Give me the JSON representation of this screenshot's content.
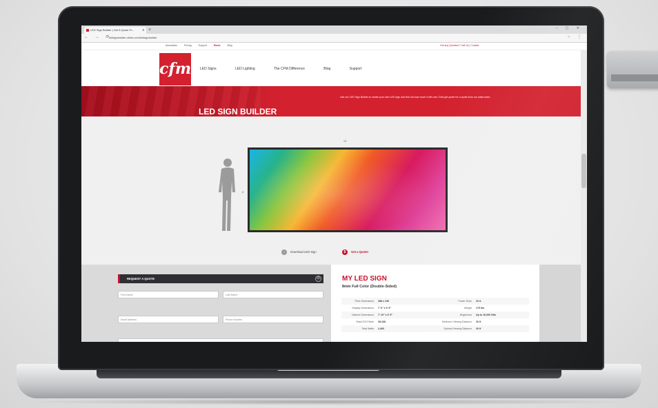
{
  "browser": {
    "tab_title": "LED Sign Builder | Get A Quote Fr...",
    "tab_close": "x",
    "new_tab": "+",
    "window_controls": "– ▢ ✕",
    "nav_glyphs": "← → ⟳",
    "url": "ledsignbuilder.cfmle.com/ledsignbuilder",
    "addr_right": "☆",
    "menu": "⋮"
  },
  "site": {
    "topnav": [
      "Associates",
      "Pricing",
      "Support",
      "Home",
      "Blog"
    ],
    "top_right": "Got any Question? Call Us  |  Contact",
    "logo": "cfm",
    "mainnav": [
      "LED Signs",
      "LED Lighting",
      "The CFM Difference",
      "Blog",
      "Support"
    ],
    "banner_title": "LED SIGN BUILDER",
    "banner_desc": "Use our LED Sign Builder to create your own LED sign and find out how much it will cost. Click get quote for a quote from our sales team.",
    "dim_top": "10'",
    "dim_side": "6'",
    "actions": {
      "download": "Download LED Sign",
      "quote": "Get a Quote!"
    },
    "quote": {
      "title": "REQUEST A QUOTE",
      "toggle": "⊖",
      "fields": [
        "First Name",
        "Last Name",
        "Email Address",
        "Phone Number"
      ]
    },
    "my_sign": {
      "title": "MY LED SIGN",
      "subtitle": "8mm Full Color (Double-Sided)",
      "specs_left": [
        {
          "k": "Pixel Dimensions",
          "v": "288 x 136"
        },
        {
          "k": "Display Dimensions",
          "v": "7' 6\" x 3' 5\""
        },
        {
          "k": "Cabinet Dimensions",
          "v": "7' 10\" x 3' 9\""
        },
        {
          "k": "Total LED Pixels",
          "v": "39,168"
        },
        {
          "k": "Total Watts",
          "v": "2,400"
        }
      ],
      "specs_right": [
        {
          "k": "Power Draw",
          "v": "20 A"
        },
        {
          "k": "Weight",
          "v": "175 lbs"
        },
        {
          "k": "Brightness",
          "v": "Up to 10,000 Nits"
        },
        {
          "k": "Minimum Viewing Distance",
          "v": "26 ft"
        },
        {
          "k": "Optimal Viewing Distance",
          "v": "26 ft"
        }
      ]
    }
  },
  "colors": {
    "brand_red": "#d3212f",
    "dark": "#2e2e33"
  }
}
